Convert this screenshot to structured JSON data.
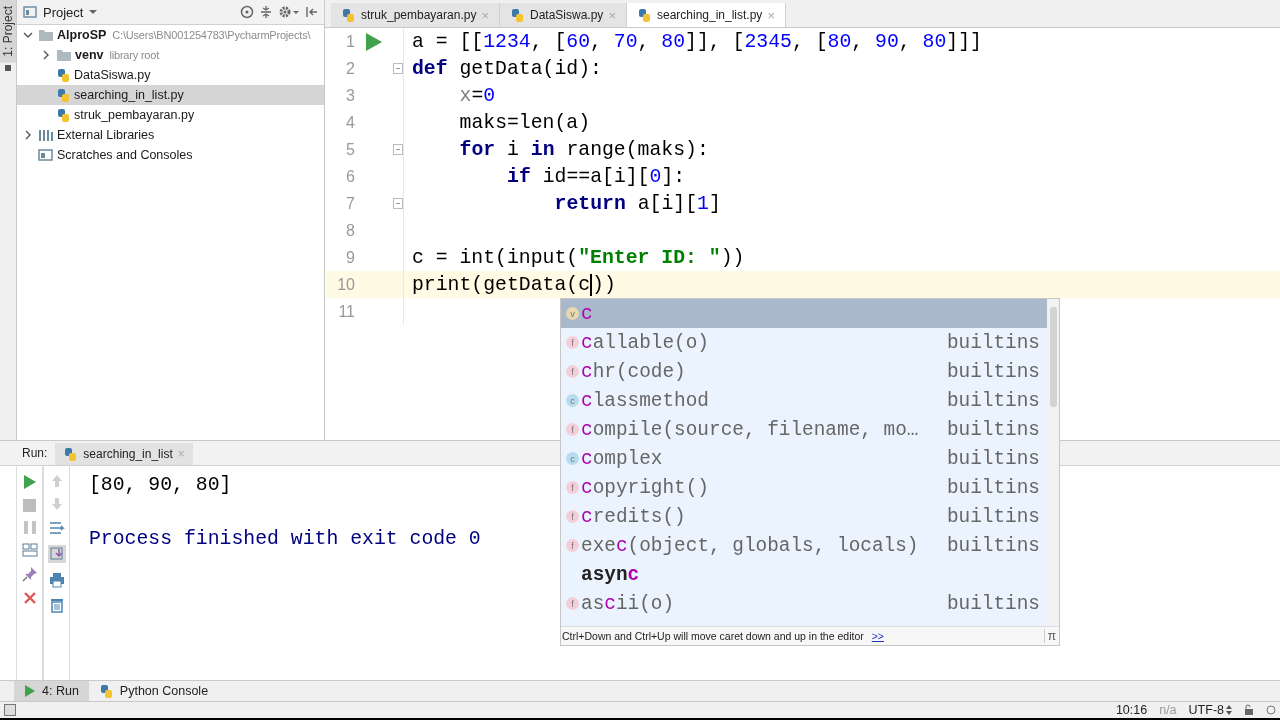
{
  "project_panel": {
    "tool_button": "1: Project",
    "title": "Project",
    "tree": [
      {
        "kind": "module",
        "name": "AlproSP",
        "hint": "C:\\Users\\BN001254783\\PycharmProjects\\",
        "expanded": true,
        "selected": false,
        "children": [
          {
            "kind": "folder",
            "name": "venv",
            "hint": "library root",
            "expanded": false,
            "selected": false
          },
          {
            "kind": "file",
            "name": "DataSiswa.py",
            "selected": false
          },
          {
            "kind": "file",
            "name": "searching_in_list.py",
            "selected": true
          },
          {
            "kind": "file",
            "name": "struk_pembayaran.py",
            "selected": false
          }
        ]
      },
      {
        "kind": "libraries",
        "name": "External Libraries",
        "expanded": false,
        "selected": false
      },
      {
        "kind": "scratches",
        "name": "Scratches and Consoles",
        "selected": false
      }
    ]
  },
  "editor": {
    "tabs": [
      {
        "label": "struk_pembayaran.py",
        "close": "×",
        "selected": false
      },
      {
        "label": "DataSiswa.py",
        "close": "×",
        "selected": false
      },
      {
        "label": "searching_in_list.py",
        "close": "×",
        "selected": true
      }
    ],
    "lines": [
      {
        "number": "1",
        "runnable": true,
        "foldable": false,
        "current": false,
        "tokens": [
          {
            "kind": "plain",
            "text": "a = [["
          },
          {
            "kind": "number",
            "text": "1234"
          },
          {
            "kind": "plain",
            "text": ", ["
          },
          {
            "kind": "number",
            "text": "60"
          },
          {
            "kind": "plain",
            "text": ", "
          },
          {
            "kind": "number",
            "text": "70"
          },
          {
            "kind": "plain",
            "text": ", "
          },
          {
            "kind": "number",
            "text": "80"
          },
          {
            "kind": "plain",
            "text": "]], ["
          },
          {
            "kind": "number",
            "text": "2345"
          },
          {
            "kind": "plain",
            "text": ", ["
          },
          {
            "kind": "number",
            "text": "80"
          },
          {
            "kind": "plain",
            "text": ", "
          },
          {
            "kind": "number",
            "text": "90"
          },
          {
            "kind": "plain",
            "text": ", "
          },
          {
            "kind": "number",
            "text": "80"
          },
          {
            "kind": "plain",
            "text": "]]]"
          }
        ]
      },
      {
        "number": "2",
        "runnable": false,
        "foldable": true,
        "current": false,
        "tokens": [
          {
            "kind": "keyword",
            "text": "def"
          },
          {
            "kind": "plain",
            "text": " getData(id):"
          }
        ],
        "children": [
          {
            "number": "3",
            "runnable": false,
            "foldable": false,
            "current": false,
            "tokens": [
              {
                "kind": "unused",
                "text": "x"
              },
              {
                "kind": "plain",
                "text": "="
              },
              {
                "kind": "number",
                "text": "0"
              }
            ]
          },
          {
            "number": "4",
            "runnable": false,
            "foldable": false,
            "current": false,
            "tokens": [
              {
                "kind": "plain",
                "text": "maks=len(a)"
              }
            ]
          },
          {
            "number": "5",
            "runnable": false,
            "foldable": true,
            "current": false,
            "tokens": [
              {
                "kind": "keyword",
                "text": "for"
              },
              {
                "kind": "plain",
                "text": " i "
              },
              {
                "kind": "keyword",
                "text": "in"
              },
              {
                "kind": "plain",
                "text": " range(maks):"
              }
            ],
            "children": [
              {
                "number": "6",
                "runnable": false,
                "foldable": false,
                "current": false,
                "tokens": [
                  {
                    "kind": "keyword",
                    "text": "if"
                  },
                  {
                    "kind": "plain",
                    "text": " id==a[i]["
                  },
                  {
                    "kind": "number",
                    "text": "0"
                  },
                  {
                    "kind": "plain",
                    "text": "]:"
                  }
                ],
                "children": [
                  {
                    "number": "7",
                    "runnable": false,
                    "foldable": true,
                    "current": false,
                    "tokens": [
                      {
                        "kind": "keyword",
                        "text": "return"
                      },
                      {
                        "kind": "plain",
                        "text": " a[i]["
                      },
                      {
                        "kind": "number",
                        "text": "1"
                      },
                      {
                        "kind": "plain",
                        "text": "]"
                      }
                    ]
                  }
                ]
              }
            ]
          }
        ]
      },
      {
        "number": "8",
        "runnable": false,
        "foldable": false,
        "current": false
      },
      {
        "number": "9",
        "runnable": false,
        "foldable": false,
        "current": false,
        "tokens": [
          {
            "kind": "plain",
            "text": "c = int(input("
          },
          {
            "kind": "string",
            "text": "\"Enter ID: \""
          },
          {
            "kind": "plain",
            "text": "))"
          }
        ]
      },
      {
        "number": "10",
        "runnable": false,
        "foldable": false,
        "current": true,
        "tokens": [
          {
            "kind": "plain",
            "text": "print(getData(c"
          },
          {
            "kind": "caret"
          },
          {
            "kind": "plain",
            "text": "))"
          }
        ]
      },
      {
        "number": "11",
        "runnable": false,
        "foldable": false,
        "current": false
      }
    ]
  },
  "completion": {
    "items": [
      {
        "kind": "variable",
        "badge": "v",
        "selected": true,
        "parts": [
          {
            "text": "c",
            "match": true
          }
        ]
      },
      {
        "kind": "function",
        "badge": "f",
        "selected": false,
        "source": "builtins",
        "parts": [
          {
            "text": "c",
            "match": true
          },
          {
            "text": "allable(o)",
            "match": false
          }
        ]
      },
      {
        "kind": "function",
        "badge": "f",
        "selected": false,
        "source": "builtins",
        "parts": [
          {
            "text": "c",
            "match": true
          },
          {
            "text": "hr(code)",
            "match": false
          }
        ]
      },
      {
        "kind": "class",
        "badge": "c",
        "selected": false,
        "source": "builtins",
        "parts": [
          {
            "text": "c",
            "match": true
          },
          {
            "text": "lassmethod",
            "match": false
          }
        ]
      },
      {
        "kind": "function",
        "badge": "f",
        "selected": false,
        "source": "builtins",
        "parts": [
          {
            "text": "c",
            "match": true
          },
          {
            "text": "ompile(source, filename, mo…",
            "match": false
          }
        ]
      },
      {
        "kind": "class",
        "badge": "c",
        "selected": false,
        "source": "builtins",
        "parts": [
          {
            "text": "c",
            "match": true
          },
          {
            "text": "omplex",
            "match": false
          }
        ]
      },
      {
        "kind": "function",
        "badge": "f",
        "selected": false,
        "source": "builtins",
        "parts": [
          {
            "text": "c",
            "match": true
          },
          {
            "text": "opyright()",
            "match": false
          }
        ]
      },
      {
        "kind": "function",
        "badge": "f",
        "selected": false,
        "source": "builtins",
        "parts": [
          {
            "text": "c",
            "match": true
          },
          {
            "text": "redits()",
            "match": false
          }
        ]
      },
      {
        "kind": "function",
        "badge": "f",
        "selected": false,
        "source": "builtins",
        "parts": [
          {
            "text": "exe",
            "match": false
          },
          {
            "text": "c",
            "match": true
          },
          {
            "text": "(object, globals, locals)",
            "match": false
          }
        ]
      },
      {
        "kind": "keyword",
        "selected": false,
        "parts": [
          {
            "text": "asyn",
            "match": false
          },
          {
            "text": "c",
            "match": true
          }
        ]
      },
      {
        "kind": "function",
        "badge": "f",
        "selected": false,
        "source": "builtins",
        "parts": [
          {
            "text": "as",
            "match": false
          },
          {
            "text": "c",
            "match": true
          },
          {
            "text": "ii(o)",
            "match": false
          }
        ]
      }
    ],
    "hint": "Ctrl+Down and Ctrl+Up will move caret down and up in the editor",
    "hint_link": ">>",
    "corner": "π"
  },
  "run_panel": {
    "label": "Run:",
    "tab": {
      "label": "searching_in_list",
      "close": "×"
    },
    "output": [
      {
        "kind": "stdout",
        "text": "[80, 90, 80]"
      },
      {
        "kind": "system",
        "text": "Process finished with exit code 0"
      }
    ]
  },
  "tool_tabs": [
    {
      "label": "4: Run",
      "selected": true
    },
    {
      "label": "Python Console",
      "selected": false
    }
  ],
  "status_bar": {
    "position": "10:16",
    "line_separator": "n/a",
    "encoding": "UTF-8"
  }
}
